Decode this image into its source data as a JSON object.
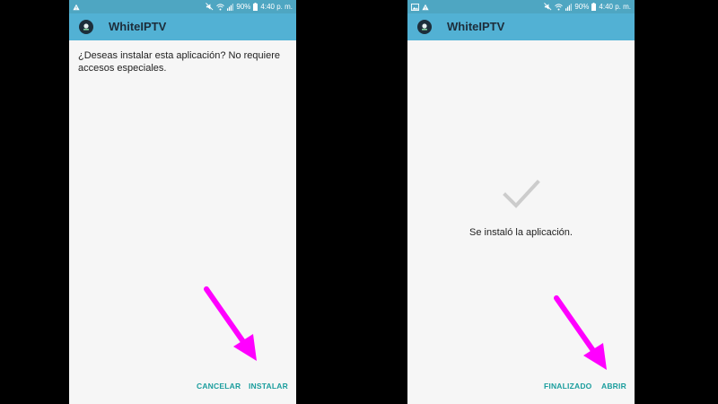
{
  "left_screen": {
    "status": {
      "battery": "90%",
      "time": "4:40 p. m."
    },
    "app_title": "WhiteIPTV",
    "prompt": "¿Deseas instalar esta aplicación? No requiere accesos especiales.",
    "cancel_label": "CANCELAR",
    "install_label": "INSTALAR"
  },
  "right_screen": {
    "status": {
      "battery": "90%",
      "time": "4:40 p. m."
    },
    "app_title": "WhiteIPTV",
    "message": "Se instaló la aplicación.",
    "done_label": "FINALIZADO",
    "open_label": "ABRIR"
  },
  "icons": {
    "status_left_left": [
      "warning-icon"
    ],
    "status_left_right": [
      "image-icon",
      "warning-icon"
    ],
    "status_right": [
      "mute-icon",
      "wifi-icon",
      "signal-icon",
      "battery-icon"
    ],
    "app": "app-logo-icon",
    "success": "check-icon",
    "annotation": "arrow-icon"
  },
  "colors": {
    "status_bar": "#4ea6c2",
    "app_bar": "#52b1d4",
    "screen_bg": "#f6f6f6",
    "button_text": "#1a9d9d",
    "annotation_arrow": "#ff00ff",
    "check": "#cccccc"
  }
}
